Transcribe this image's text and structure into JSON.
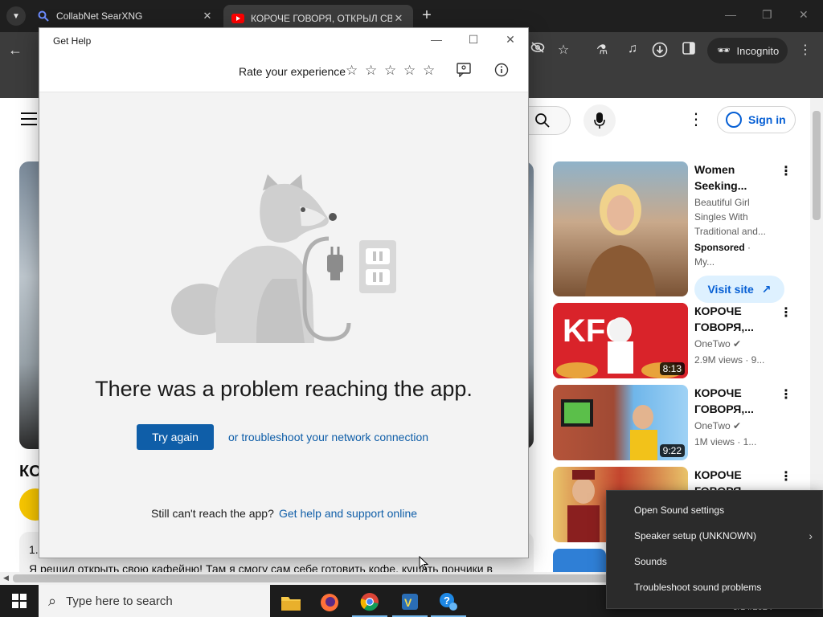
{
  "browser": {
    "tabs": [
      {
        "title": "CollabNet SearXNG"
      },
      {
        "title": "КОРОЧЕ ГОВОРЯ, ОТКРЫЛ СВОЁ КАФЕ"
      }
    ],
    "incognito_label": "Incognito"
  },
  "youtube": {
    "signin_label": "Sign in",
    "video_title_partial": "КО",
    "description_line1": "1.",
    "description_line2": "Я решил открыть свою кафейню! Там я смогу сам себе готовить кофе, кушать пончики в",
    "recommendations": [
      {
        "title": "Women Seeking...",
        "meta1": "Beautiful Girl Singles With Traditional and...",
        "sponsored": "Sponsored",
        "meta2": "· My...",
        "button": "Visit site"
      },
      {
        "title": "КОРОЧЕ ГОВОРЯ,...",
        "channel": "OneTwo",
        "views": "2.9M views · 9...",
        "duration": "8:13"
      },
      {
        "title": "КОРОЧЕ ГОВОРЯ,...",
        "channel": "OneTwo",
        "views": "1M views · 1...",
        "duration": "9:22"
      },
      {
        "title": "КОРОЧЕ ГОВОРЯ,..."
      }
    ]
  },
  "gethelp": {
    "window_title": "Get Help",
    "rate_label": "Rate your experience",
    "error_heading": "There was a problem reaching the app.",
    "try_again": "Try again",
    "troubleshoot_link": "or troubleshoot your network connection",
    "still_cant": "Still can't reach the app?",
    "support_link": "Get help and support online"
  },
  "taskbar": {
    "search_placeholder": "Type here to search",
    "date": "9/14/2024"
  },
  "sound_menu": {
    "items": [
      {
        "label": "Open Sound settings"
      },
      {
        "label": "Speaker setup (UNKNOWN)"
      },
      {
        "label": "Sounds"
      },
      {
        "label": "Troubleshoot sound problems"
      }
    ]
  },
  "colors": {
    "accent_blue": "#0f5ea8",
    "youtube_red": "#ff0000",
    "youtube_link": "#065fd4"
  }
}
